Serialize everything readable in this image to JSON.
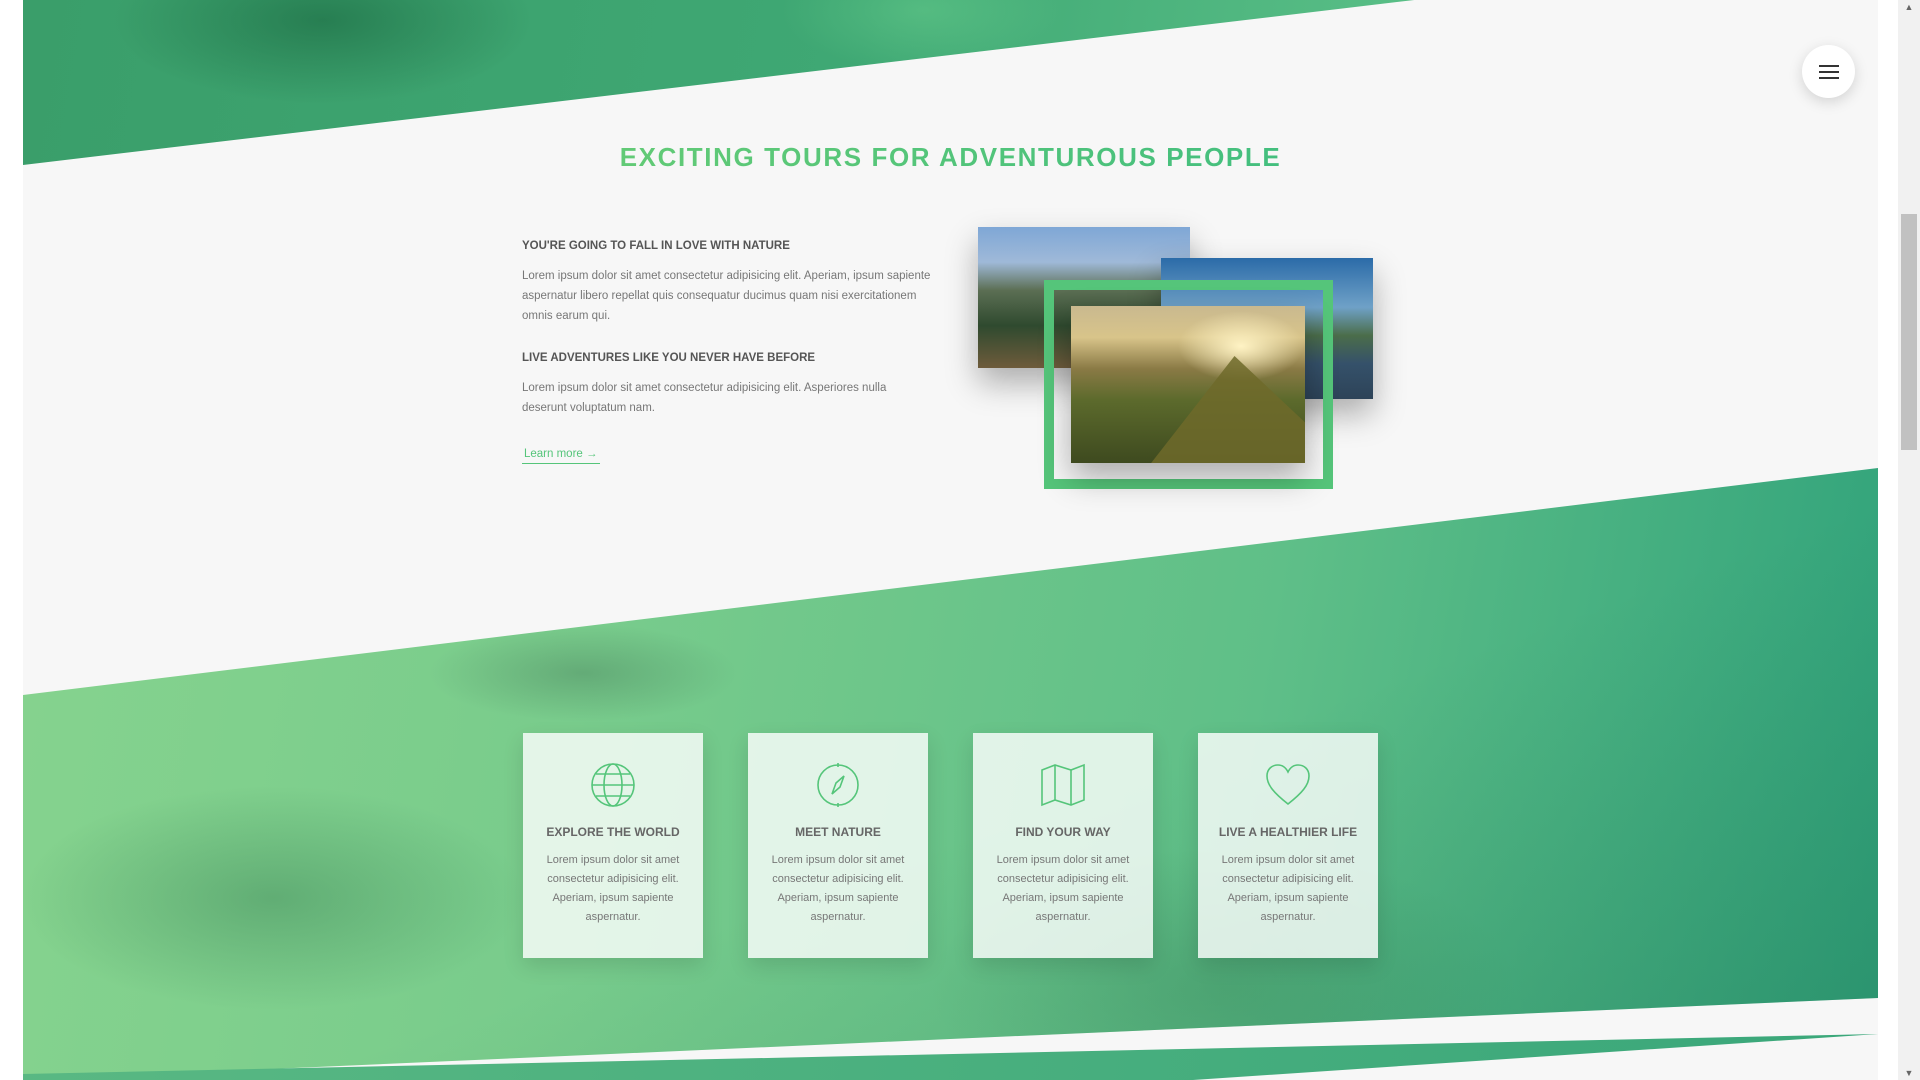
{
  "section": {
    "title": "EXCITING TOURS FOR ADVENTUROUS PEOPLE",
    "heading1": "YOU'RE GOING TO FALL IN LOVE WITH NATURE",
    "paragraph1": "Lorem ipsum dolor sit amet consectetur adipisicing elit. Aperiam, ipsum sapiente aspernatur libero repellat quis consequatur ducimus quam nisi exercitationem omnis earum qui.",
    "heading2": "LIVE ADVENTURES LIKE YOU NEVER HAVE BEFORE",
    "paragraph2": "Lorem ipsum dolor sit amet consectetur adipisicing elit. Asperiores nulla deserunt voluptatum nam.",
    "learn_more": "Learn more →"
  },
  "features": [
    {
      "icon": "globe-icon",
      "title": "EXPLORE THE WORLD",
      "text": "Lorem ipsum dolor sit amet consectetur adipisicing elit. Aperiam, ipsum sapiente aspernatur."
    },
    {
      "icon": "compass-icon",
      "title": "MEET NATURE",
      "text": "Lorem ipsum dolor sit amet consectetur adipisicing elit. Aperiam, ipsum sapiente aspernatur."
    },
    {
      "icon": "map-icon",
      "title": "FIND YOUR WAY",
      "text": "Lorem ipsum dolor sit amet consectetur adipisicing elit. Aperiam, ipsum sapiente aspernatur."
    },
    {
      "icon": "heart-icon",
      "title": "LIVE A HEALTHIER LIFE",
      "text": "Lorem ipsum dolor sit amet consectetur adipisicing elit. Aperiam, ipsum sapiente aspernatur."
    }
  ],
  "colors": {
    "accent": "#55c57a",
    "accent_dark": "#28b485",
    "accent_light": "#7ed56f"
  },
  "nav": {
    "icon": "hamburger-icon"
  }
}
